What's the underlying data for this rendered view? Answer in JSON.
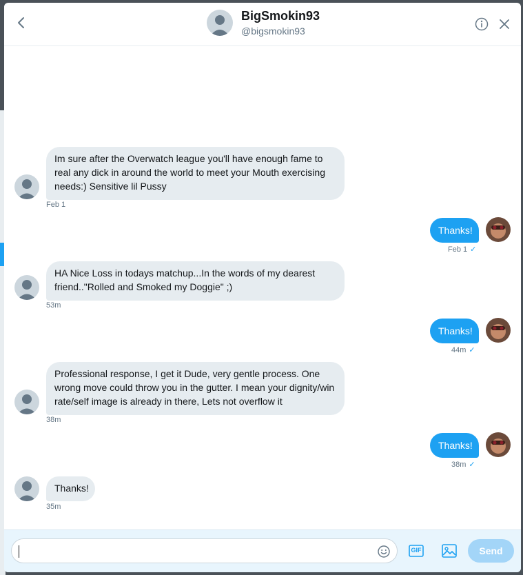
{
  "header": {
    "name": "BigSmokin93",
    "handle": "@bigsmokin93",
    "back_icon": "chevron-left-icon",
    "info_icon": "info-icon",
    "close_icon": "close-icon"
  },
  "messages": [
    {
      "direction": "in",
      "text": "Im sure after the Overwatch league you'll have enough fame to real any dick in around the world to meet your Mouth exercising needs:) Sensitive lil Pussy",
      "time": "Feb 1"
    },
    {
      "direction": "out",
      "text": "Thanks!",
      "time": "Feb 1"
    },
    {
      "direction": "in",
      "text": "HA Nice Loss in todays matchup...In the words of my dearest friend..\"Rolled and Smoked my Doggie\" ;)",
      "time": "53m"
    },
    {
      "direction": "out",
      "text": "Thanks!",
      "time": "44m"
    },
    {
      "direction": "in",
      "text": "Professional response, I get it Dude, very gentle process. One wrong move could throw you in the gutter. I mean your dignity/win rate/self image is already in there, Lets not overflow it",
      "time": "38m"
    },
    {
      "direction": "out",
      "text": "Thanks!",
      "time": "38m"
    },
    {
      "direction": "in",
      "text": "Thanks!",
      "time": "35m"
    }
  ],
  "composer": {
    "value": "",
    "emoji_icon": "emoji-icon",
    "gif_label": "GIF",
    "image_icon": "image-icon",
    "send_label": "Send"
  },
  "check_glyph": "✓",
  "colors": {
    "accent": "#1da1f2",
    "incoming_bubble": "#e6ecf0",
    "send_disabled": "#a3d5f8"
  }
}
